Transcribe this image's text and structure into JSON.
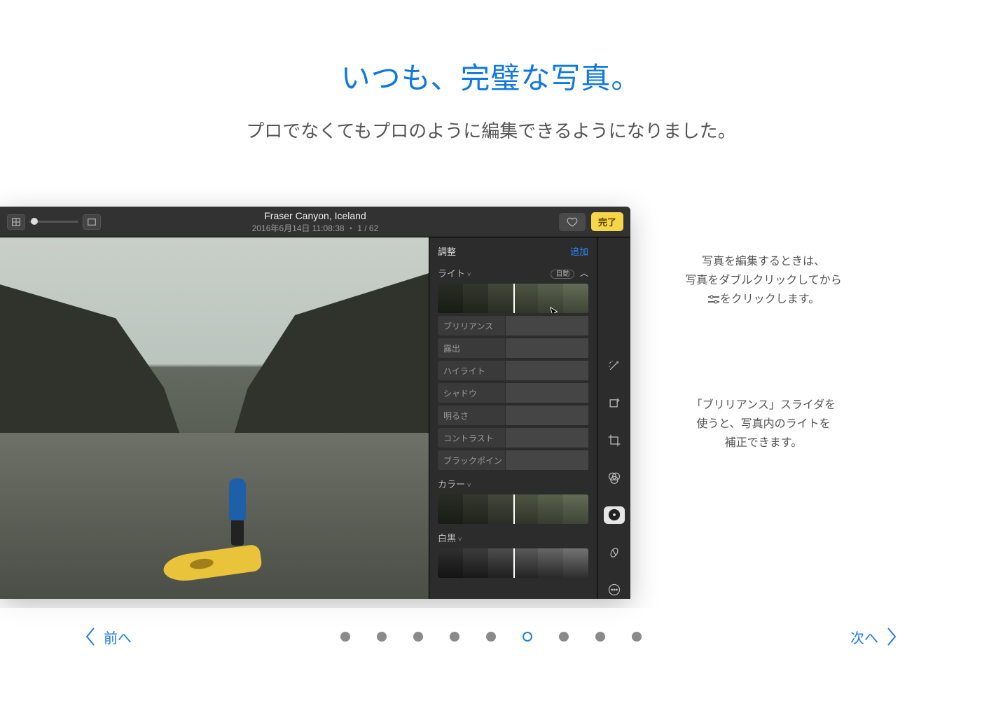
{
  "hero": {
    "title": "いつも、完璧な写真。",
    "subtitle": "プロでなくてもプロのように編集できるようになりました。"
  },
  "editor": {
    "photo_title": "Fraser Canyon, Iceland",
    "photo_meta": "2016年6月14日 11:08:38 ・ 1 / 62",
    "done_label": "完了",
    "panel": {
      "header_label": "調整",
      "add_label": "追加",
      "sections": {
        "light": {
          "name": "ライト",
          "auto_label": "自動"
        },
        "color": {
          "name": "カラー"
        },
        "bw": {
          "name": "白黒"
        }
      },
      "sliders": [
        "ブリリアンス",
        "露出",
        "ハイライト",
        "シャドウ",
        "明るさ",
        "コントラスト",
        "ブラックポイント"
      ]
    },
    "tools": [
      "magic-wand-icon",
      "rotate-icon",
      "crop-icon",
      "filters-icon",
      "adjust-icon",
      "retouch-icon",
      "more-icon"
    ]
  },
  "callouts": {
    "c1_l1": "写真を編集するときは、",
    "c1_l2": "写真をダブルクリックしてから",
    "c1_l3_suffix": "をクリックします。",
    "c2_l1": "「ブリリアンス」スライダを",
    "c2_l2": "使うと、写真内のライトを",
    "c2_l3": "補正できます。"
  },
  "pager": {
    "prev_label": "前へ",
    "next_label": "次へ",
    "total_dots": 9,
    "active_index": 5
  }
}
